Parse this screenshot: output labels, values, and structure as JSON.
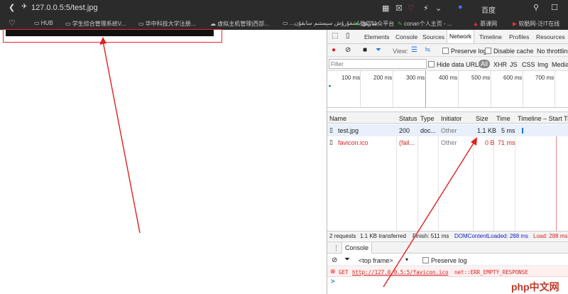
{
  "browser": {
    "url": "127.0.0.5:5/test.jpg",
    "search_engine": "百度",
    "bookmarks": [
      "HUB",
      "学生综合管理系统V...",
      "华中科技大学注册...",
      "虚拟主机管理|西部...",
      "...شاريق باشقۇرۇش سېستىم سابقۇن",
      "微信公众平台",
      "conan个人主页 - ...",
      "慕课网",
      "软酷网-泛IT在线"
    ]
  },
  "devtools": {
    "tabs": [
      "Elements",
      "Console",
      "Sources",
      "Network",
      "Timeline",
      "Profiles",
      "Resources"
    ],
    "active_tab": "Network",
    "toolbar": {
      "view_label": "View:",
      "preserve_log": "Preserve log",
      "disable_cache": "Disable cache",
      "throttling": "No throttling"
    },
    "filter": {
      "placeholder": "Filter",
      "hide_data_urls": "Hide data URLs",
      "types": [
        "All",
        "XHR",
        "JS",
        "CSS",
        "Img",
        "Media"
      ]
    },
    "timeline_ticks": [
      "100 ms",
      "200 ms",
      "300 ms",
      "400 ms",
      "500 ms",
      "600 ms",
      "700 ms"
    ],
    "columns": [
      "Name",
      "Status",
      "Type",
      "Initiator",
      "Size",
      "Time",
      "Timeline – Start Time"
    ],
    "requests": [
      {
        "name": "test.jpg",
        "status": "200",
        "type": "doc...",
        "initiator": "Other",
        "size": "1.1 KB",
        "time": "5 ms",
        "error": false
      },
      {
        "name": "favicon.ico",
        "status": "(fail...",
        "type": "",
        "initiator": "Other",
        "size": "0 B",
        "time": "71 ms",
        "error": true
      }
    ],
    "summary": {
      "requests": "2 requests",
      "transferred": "1.1 KB transferred",
      "finish": "Finish: 511 ms",
      "dom": "DOMContentLoaded: 288 ms",
      "load": "Load: 288 ms"
    },
    "console": {
      "tab": "Console",
      "frame": "<top frame>",
      "preserve_log": "Preserve log",
      "error_method": "GET",
      "error_url": "http://127.0.0.5:5/favicon.ico",
      "error_text": "net::ERR_EMPTY_RESPONSE",
      "prompt": ">"
    }
  },
  "watermark": "php中文网",
  "colors": {
    "annotation": "#e02020",
    "error": "#d22",
    "accent": "#1a73e8"
  }
}
